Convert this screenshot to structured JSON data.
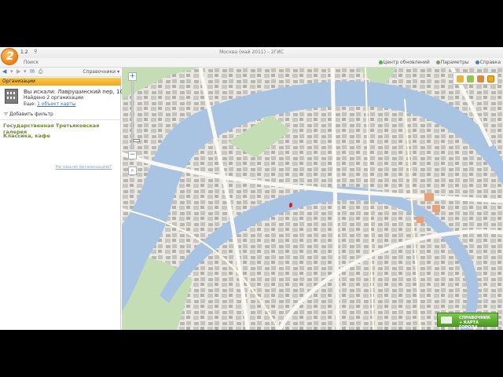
{
  "app": {
    "version": "1.2",
    "title": "Москва (май 2011) – 2ГИС",
    "search_tab": "Поиск"
  },
  "topbar": {
    "update_center": "Центр обновлений",
    "parameters": "Параметры",
    "help": "Справка"
  },
  "sidebar": {
    "directories_label": "Справочники",
    "section_title": "Организации",
    "query_text": "Вы искали: Лаврушинский пер, 10",
    "found_text": "Найдено 2 организации",
    "also_prefix": "Еще:",
    "also_link": "1 объект карты",
    "add_filter": "Добавить фильтр",
    "organizations": [
      {
        "name": "Государственная Третьяковская галерея"
      },
      {
        "name": "Классика, кафе"
      }
    ],
    "not_found_link": "Не нашли организацию?"
  },
  "map": {
    "ad_line1": "СПРАВОЧНИК",
    "ad_line2": "+ КАРТА ГОРОДА",
    "zoom_in": "+",
    "zoom_out": "−"
  },
  "colors": {
    "accent_orange": "#f0a81e",
    "river": "#a9c3e3",
    "park": "#c4ddb4",
    "link": "#3b6fb6",
    "org_green": "#6b8a2e"
  }
}
